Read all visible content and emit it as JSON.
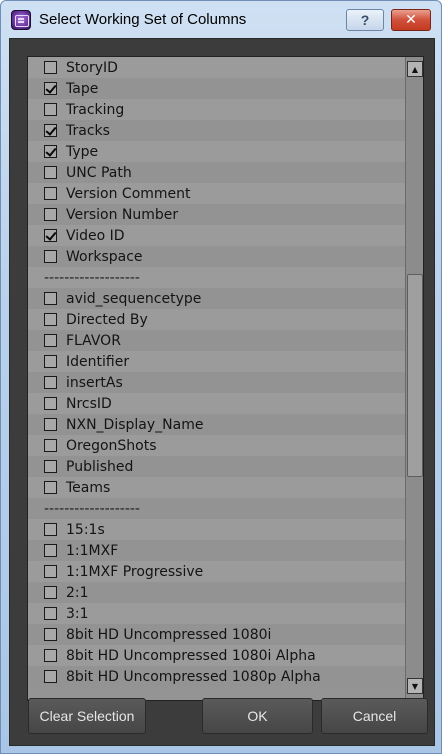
{
  "window": {
    "title": "Select Working Set of Columns",
    "help_label": "?",
    "close_label": "✕"
  },
  "list": {
    "items": [
      {
        "type": "item",
        "label": "StoryID",
        "checked": false
      },
      {
        "type": "item",
        "label": "Tape",
        "checked": true
      },
      {
        "type": "item",
        "label": "Tracking",
        "checked": false
      },
      {
        "type": "item",
        "label": "Tracks",
        "checked": true
      },
      {
        "type": "item",
        "label": "Type",
        "checked": true
      },
      {
        "type": "item",
        "label": "UNC Path",
        "checked": false
      },
      {
        "type": "item",
        "label": "Version Comment",
        "checked": false
      },
      {
        "type": "item",
        "label": "Version Number",
        "checked": false
      },
      {
        "type": "item",
        "label": "Video ID",
        "checked": true
      },
      {
        "type": "item",
        "label": "Workspace",
        "checked": false
      },
      {
        "type": "separator",
        "label": "-------------------"
      },
      {
        "type": "item",
        "label": "avid_sequencetype",
        "checked": false
      },
      {
        "type": "item",
        "label": "Directed By",
        "checked": false
      },
      {
        "type": "item",
        "label": "FLAVOR",
        "checked": false
      },
      {
        "type": "item",
        "label": "Identifier",
        "checked": false
      },
      {
        "type": "item",
        "label": "insertAs",
        "checked": false
      },
      {
        "type": "item",
        "label": "NrcsID",
        "checked": false
      },
      {
        "type": "item",
        "label": "NXN_Display_Name",
        "checked": false
      },
      {
        "type": "item",
        "label": "OregonShots",
        "checked": false
      },
      {
        "type": "item",
        "label": "Published",
        "checked": false
      },
      {
        "type": "item",
        "label": "Teams",
        "checked": false
      },
      {
        "type": "separator",
        "label": "-------------------"
      },
      {
        "type": "item",
        "label": "15:1s",
        "checked": false
      },
      {
        "type": "item",
        "label": "1:1MXF",
        "checked": false
      },
      {
        "type": "item",
        "label": "1:1MXF Progressive",
        "checked": false
      },
      {
        "type": "item",
        "label": "2:1",
        "checked": false
      },
      {
        "type": "item",
        "label": "3:1",
        "checked": false
      },
      {
        "type": "item",
        "label": "8bit HD Uncompressed 1080i",
        "checked": false
      },
      {
        "type": "item",
        "label": "8bit HD Uncompressed 1080i Alpha",
        "checked": false
      },
      {
        "type": "item",
        "label": "8bit HD Uncompressed 1080p Alpha",
        "checked": false
      }
    ]
  },
  "buttons": {
    "clear_selection": "Clear Selection",
    "ok": "OK",
    "cancel": "Cancel"
  },
  "icons": {
    "app": "avid-app-icon",
    "scroll_up": "arrow-up-icon",
    "scroll_down": "arrow-down-icon"
  }
}
